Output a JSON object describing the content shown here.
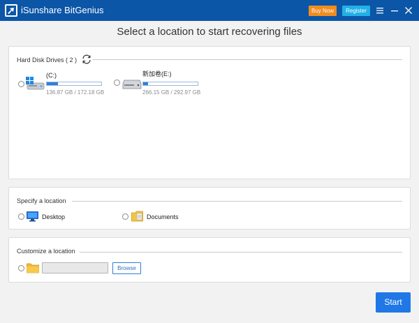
{
  "app": {
    "title": "iSunshare BitGenius",
    "buy_label": "Buy Now",
    "register_label": "Register"
  },
  "heading": "Select a location to start recovering files",
  "drives_section": {
    "title": "Hard Disk Drives ( 2 )",
    "drives": [
      {
        "name": "(C:)",
        "size_text": "136.87 GB / 172.18 GB",
        "used_fraction": 0.21,
        "icon": "windows-drive-icon"
      },
      {
        "name": "新加卷(E:)",
        "size_text": "266.15 GB / 292.97 GB",
        "used_fraction": 0.09,
        "icon": "hard-drive-icon"
      }
    ]
  },
  "location_section": {
    "title": "Specify a location",
    "items": [
      {
        "label": "Desktop",
        "icon": "desktop-icon"
      },
      {
        "label": "Documents",
        "icon": "documents-icon"
      }
    ]
  },
  "custom_section": {
    "title": "Customize a location",
    "path_value": "",
    "browse_label": "Browse"
  },
  "start_label": "Start",
  "colors": {
    "titlebar": "#0c56a8",
    "buy": "#f08c1e",
    "register": "#22b0e6",
    "accent": "#1f78e6",
    "bar_fill": "#2f7fd8"
  }
}
